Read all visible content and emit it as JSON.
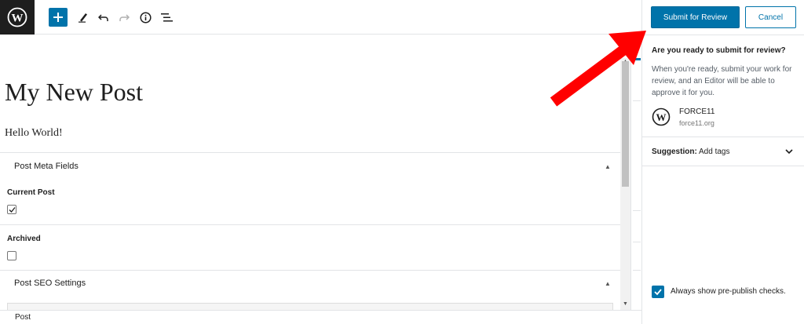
{
  "toolbar": {
    "add_block": "add-block",
    "tools": "edit-icon",
    "undo": "undo-icon",
    "redo": "redo-icon",
    "info": "info-icon",
    "outline": "list-icon"
  },
  "editor": {
    "title": "My New Post",
    "body": "Hello World!",
    "panels": [
      {
        "title": "Post Meta Fields"
      },
      {
        "title": "Post SEO Settings"
      }
    ],
    "fields": [
      {
        "label": "Current Post",
        "checked": true
      },
      {
        "label": "Archived",
        "checked": false
      }
    ]
  },
  "statusbar": {
    "breadcrumb": "Post"
  },
  "sidebar": {
    "submit_label": "Submit for Review",
    "cancel_label": "Cancel",
    "ready_title": "Are you ready to submit for review?",
    "ready_description": "When you're ready, submit your work for review, and an Editor will be able to approve it for you.",
    "site_name": "FORCE11",
    "site_url": "force11.org",
    "suggestion_label": "Suggestion:",
    "suggestion_value": "Add tags",
    "prepublish_label": "Always show pre-publish checks.",
    "prepublish_checked": true
  },
  "colors": {
    "accent": "#0073aa",
    "annotation": "#ff0000",
    "logo_bg": "#1e1e1e"
  }
}
